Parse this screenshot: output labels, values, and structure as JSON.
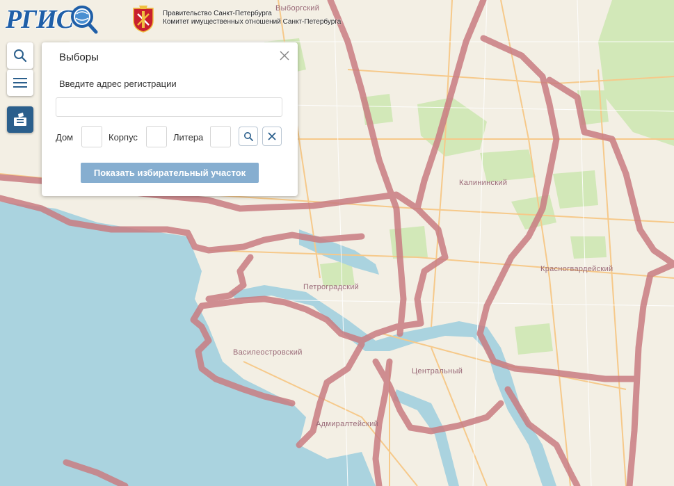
{
  "brand": {
    "logo_text": "РГИС"
  },
  "government": {
    "line1": "Правительство Санкт-Петербурга",
    "line2": "Комитет имущественных отношений Санкт-Петербурга"
  },
  "controls": {
    "search_icon": "search-icon",
    "menu_icon": "menu-icon",
    "elections_icon": "ballot-box-icon"
  },
  "panel": {
    "title": "Выборы",
    "address_label": "Введите адрес регистрации",
    "address_value": "",
    "house_label": "Дом",
    "building_label": "Корпус",
    "letter_label": "Литера",
    "show_button": "Показать избирательный участок"
  },
  "map": {
    "district_labels": {
      "vyborgsky": "Выборгский",
      "kalininsky": "Калининский",
      "krasnogvardeysky": "Красногвардейский",
      "petrogradsky": "Петроградский",
      "vasileostrovsky": "Василеостровский",
      "centralny": "Центральный",
      "admiralteysky": "Адмиралтейский"
    },
    "colors": {
      "boundary": "#c97d82",
      "water": "#aad3df",
      "park": "#cfe7b4",
      "road": "#f6c98a"
    }
  }
}
